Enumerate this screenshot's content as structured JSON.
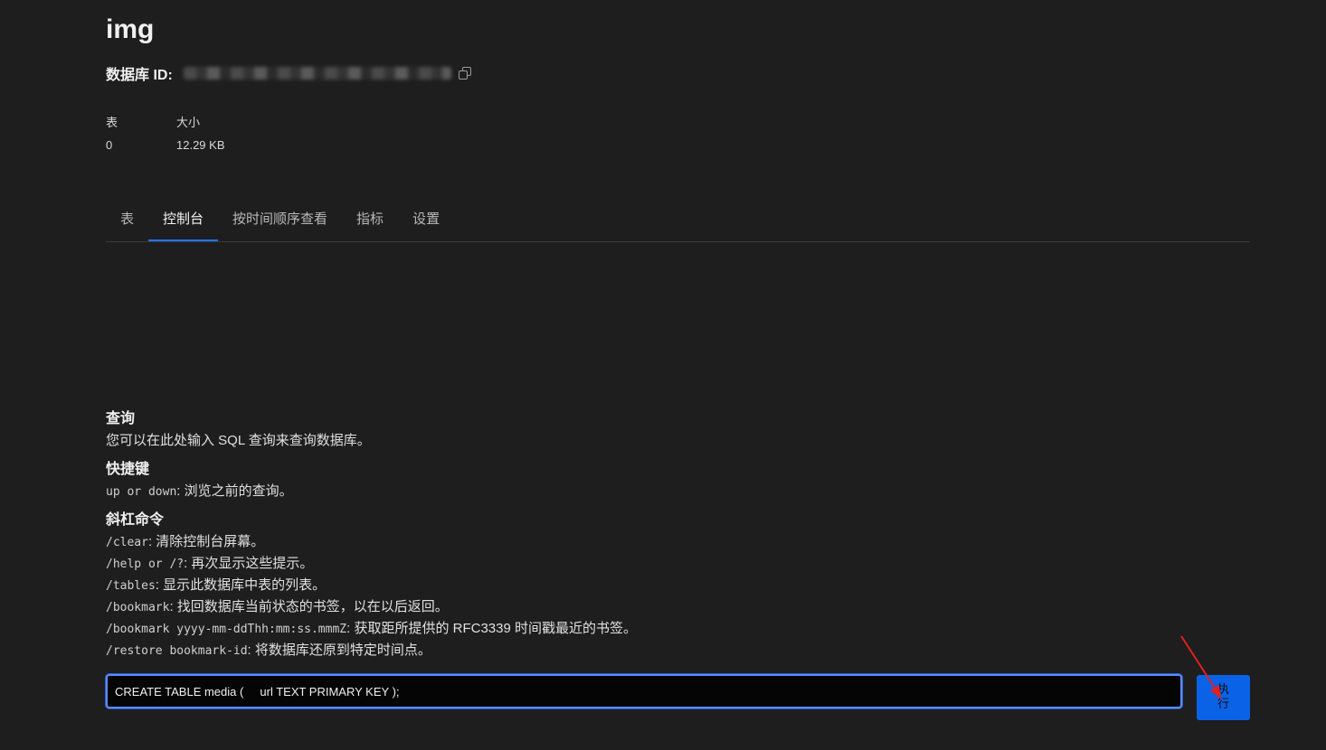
{
  "database": {
    "name": "img",
    "id_label": "数据库 ID:",
    "id_value": "0416074a-b6da-4726-9920-a0bc-b3e5c05d9e51"
  },
  "stats": {
    "tables_label": "表",
    "tables_value": "0",
    "size_label": "大小",
    "size_value": "12.29 KB"
  },
  "tabs": [
    {
      "label": "表",
      "active": false
    },
    {
      "label": "控制台",
      "active": true
    },
    {
      "label": "按时间顺序查看",
      "active": false
    },
    {
      "label": "指标",
      "active": false
    },
    {
      "label": "设置",
      "active": false
    }
  ],
  "help": {
    "query_title": "查询",
    "query_desc": "您可以在此处输入 SQL 查询来查询数据库。",
    "shortcuts_title": "快捷键",
    "shortcut_keys": "up or down",
    "shortcut_desc": ": 浏览之前的查询。",
    "slash_title": "斜杠命令",
    "commands": [
      {
        "cmd": "/clear",
        "desc": ": 清除控制台屏幕。"
      },
      {
        "cmd": "/help or /?",
        "desc": ": 再次显示这些提示。"
      },
      {
        "cmd": "/tables",
        "desc": ": 显示此数据库中表的列表。"
      },
      {
        "cmd": "/bookmark",
        "desc": ": 找回数据库当前状态的书签，以在以后返回。"
      },
      {
        "cmd": "/bookmark yyyy-mm-ddThh:mm:ss.mmmZ",
        "desc": ": 获取距所提供的 RFC3339 时间戳最近的书签。"
      },
      {
        "cmd": "/restore bookmark-id",
        "desc": ": 将数据库还原到特定时间点。"
      }
    ]
  },
  "console": {
    "input_value": "CREATE TABLE media (     url TEXT PRIMARY KEY );",
    "run_label": "执行"
  },
  "colors": {
    "background": "#1e1e1e",
    "accent": "#1f73ff",
    "button": "#0a63e6",
    "annotation": "#e02020"
  }
}
